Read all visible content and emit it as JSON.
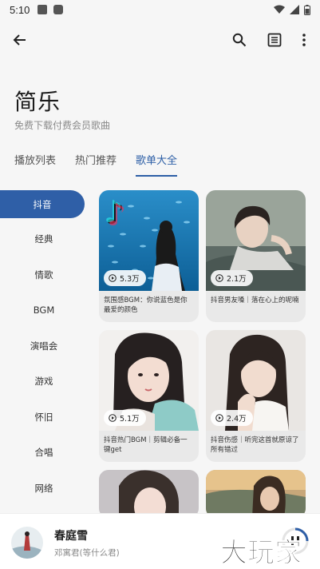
{
  "status_bar": {
    "time": "5:10"
  },
  "header": {
    "title": "简乐",
    "subtitle": "免费下载付费会员歌曲"
  },
  "tabs": [
    {
      "label": "播放列表",
      "active": false
    },
    {
      "label": "热门推荐",
      "active": false
    },
    {
      "label": "歌单大全",
      "active": true
    }
  ],
  "categories": [
    {
      "label": "抖音",
      "active": true
    },
    {
      "label": "经典"
    },
    {
      "label": "情歌"
    },
    {
      "label": "BGM"
    },
    {
      "label": "演唱会"
    },
    {
      "label": "游戏"
    },
    {
      "label": "怀旧"
    },
    {
      "label": "合唱"
    },
    {
      "label": "网络"
    }
  ],
  "playlists": [
    {
      "plays": "5.3万",
      "title": "氛围感BGM：你说蓝色是你最爱的颜色"
    },
    {
      "plays": "2.1万",
      "title": "抖音男友嗓｜落在心上的呢喃"
    },
    {
      "plays": "5.1万",
      "title": "抖音热门BGM｜剪辑必备一键get"
    },
    {
      "plays": "2.4万",
      "title": "抖音伤感｜听完这首就原谅了所有错过"
    }
  ],
  "now_playing": {
    "song": "春庭雪",
    "artist": "邓寓君(等什么君)"
  },
  "watermark": "大玩家",
  "colors": {
    "accent": "#2f5fa7",
    "background": "#f6f6f6"
  }
}
